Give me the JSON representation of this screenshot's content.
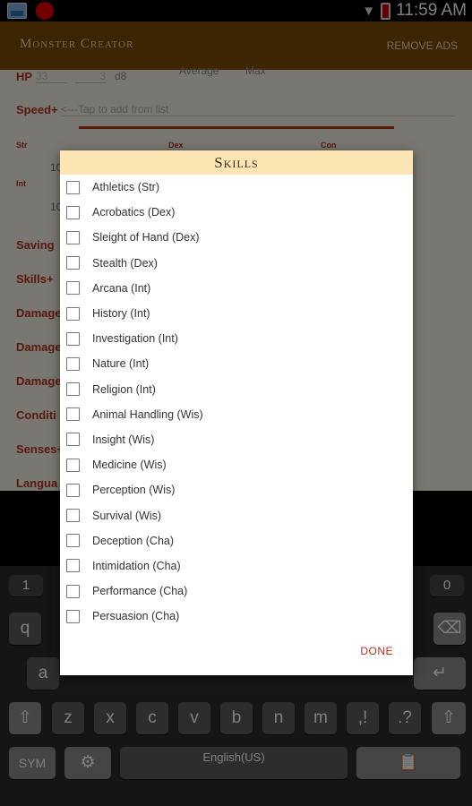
{
  "status_bar": {
    "time": "11:59 AM"
  },
  "app_bar": {
    "title": "Monster Creator",
    "remove_ads": "REMOVE ADS"
  },
  "form": {
    "hp_label": "HP",
    "hp_count": "33",
    "hp_dice": "3",
    "hp_die": "d8",
    "average_label": "Average",
    "max_label": "Max",
    "speed_label": "Speed+",
    "speed_hint": "<---Tap to add from list",
    "stats": {
      "str": "Str",
      "dex": "Dex",
      "con": "Con",
      "int": "Int",
      "str_val": "10",
      "int_val": "10"
    },
    "rows": [
      "Saving",
      "Skills+",
      "Damage",
      "Damage",
      "Damage",
      "Conditi",
      "Senses+",
      "Langua"
    ]
  },
  "dialog": {
    "title": "Skills",
    "skills": [
      "Athletics (Str)",
      "Acrobatics (Dex)",
      "Sleight of Hand (Dex)",
      "Stealth (Dex)",
      "Arcana (Int)",
      "History (Int)",
      "Investigation (Int)",
      "Nature (Int)",
      "Religion (Int)",
      "Animal Handling (Wis)",
      "Insight (Wis)",
      "Medicine (Wis)",
      "Perception (Wis)",
      "Survival (Wis)",
      "Deception (Cha)",
      "Intimidation (Cha)",
      "Performance (Cha)",
      "Persuasion (Cha)"
    ],
    "done_label": "DONE"
  },
  "keyboard": {
    "num_left": "1",
    "num_right": "0",
    "q": "q",
    "a": "a",
    "row3": [
      "z",
      "x",
      "c",
      "v",
      "b",
      "n",
      "m",
      ",!",
      ".?"
    ],
    "sym": "SYM",
    "language": "English(US)"
  }
}
